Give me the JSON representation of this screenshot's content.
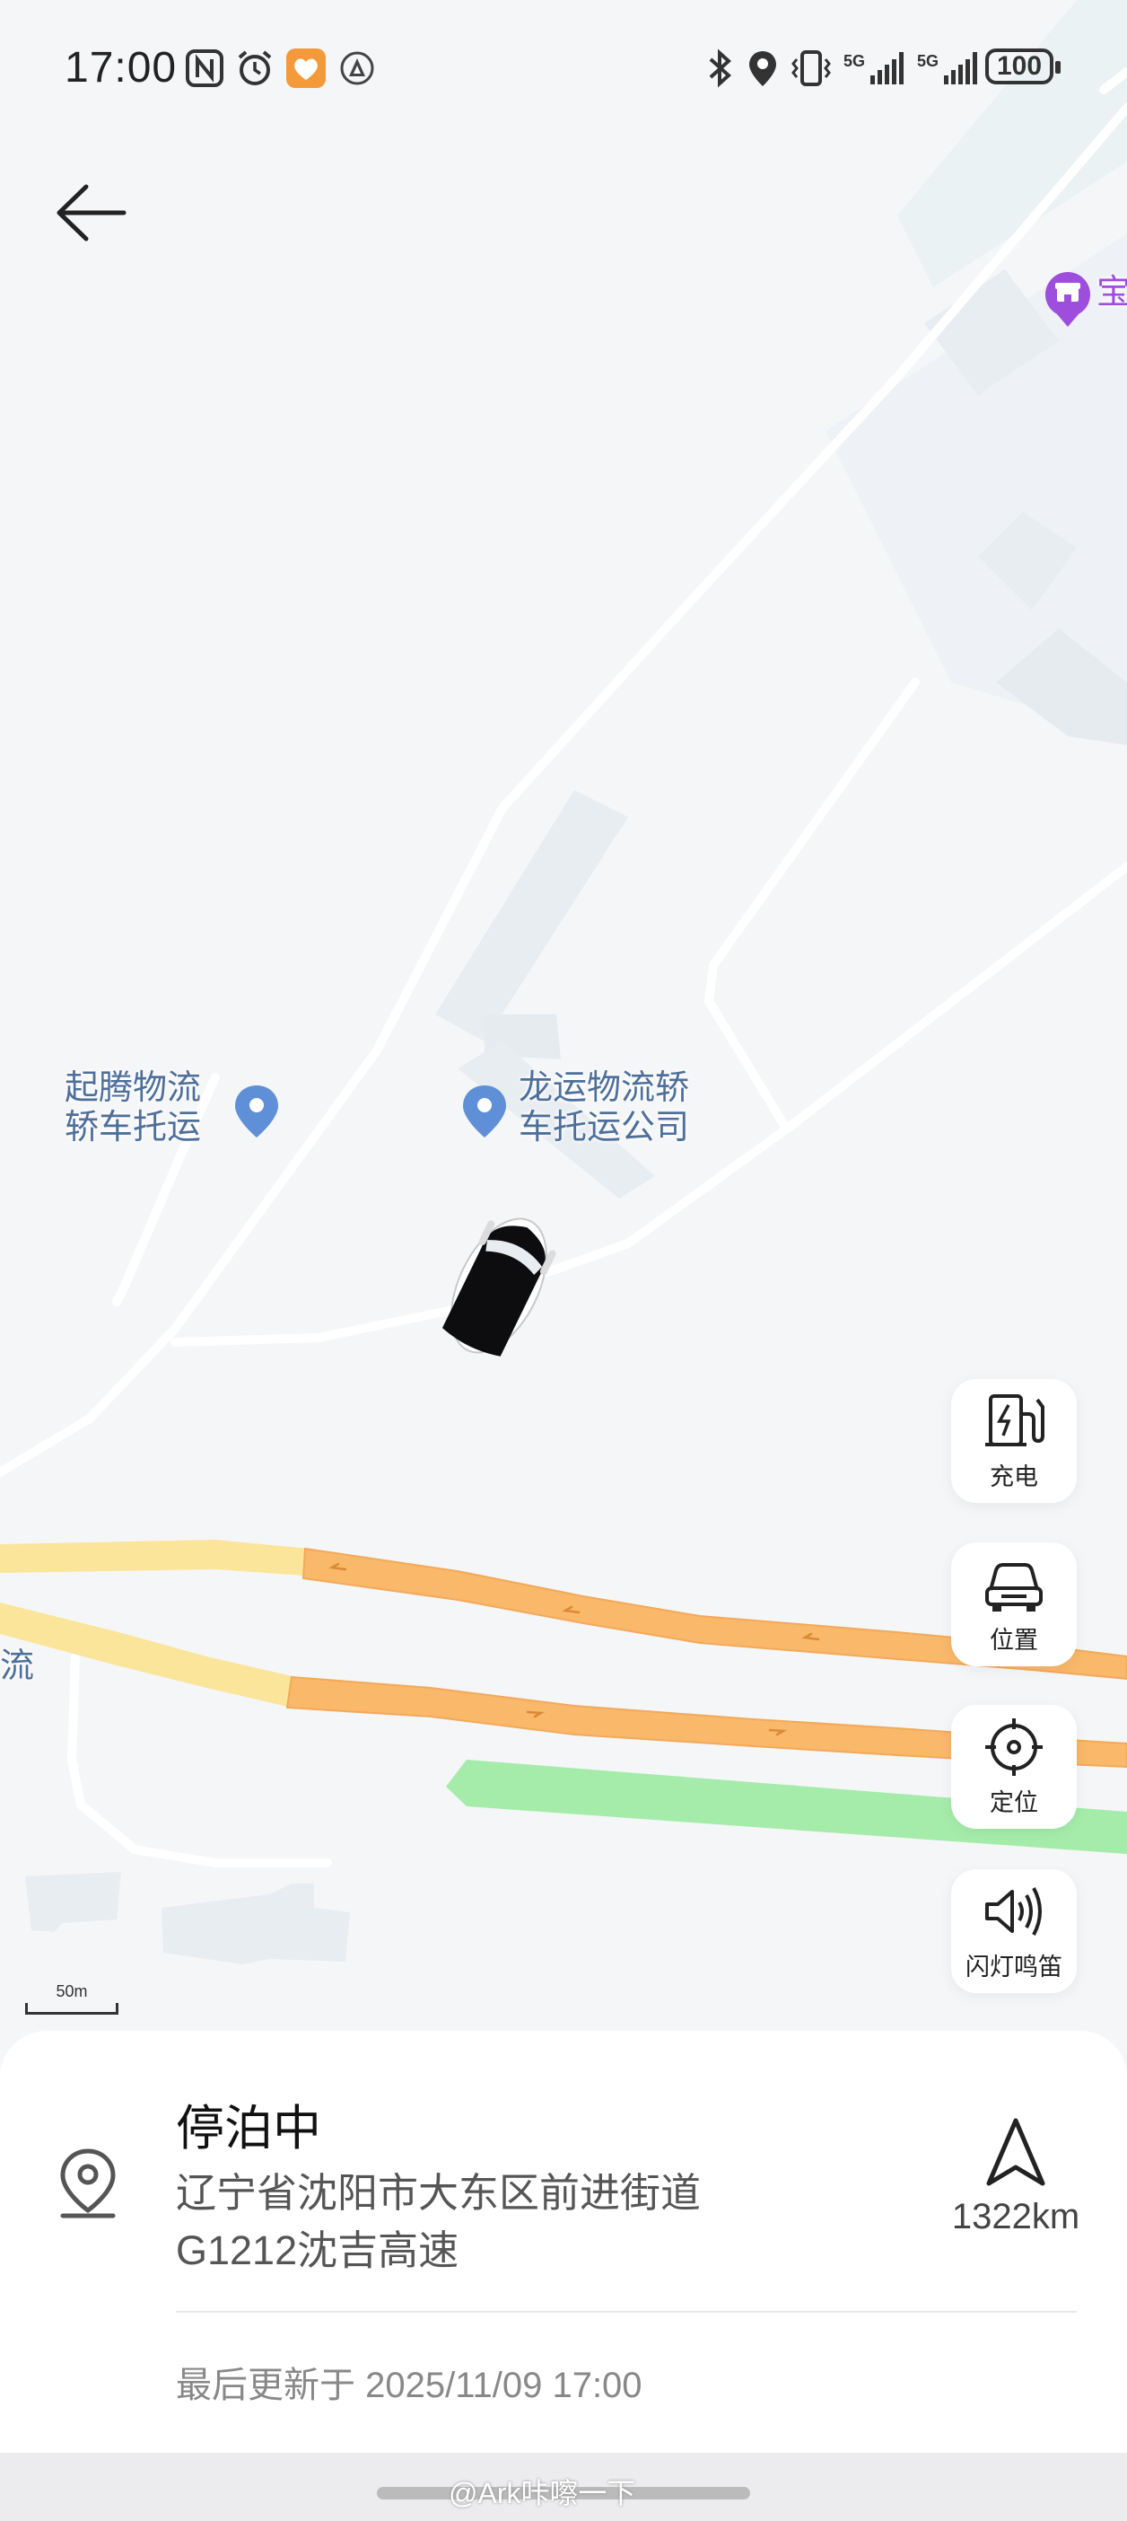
{
  "status_bar": {
    "time": "17:00",
    "icons": [
      "nfc-icon",
      "alarm-icon",
      "heart-app-icon",
      "navigation-app-icon",
      "bluetooth-icon",
      "location-icon",
      "vibrate-icon",
      "signal-5g-icon",
      "signal-5g-icon"
    ],
    "signal_label_1": "5G",
    "signal_label_2": "5G",
    "battery": "100"
  },
  "map": {
    "pois": [
      {
        "name": "起腾物流\n轿车托运"
      },
      {
        "name": "龙运物流轿\n车托运公司"
      }
    ],
    "edge_label_right": "宝",
    "edge_label_left": "流",
    "scale_label": "50m"
  },
  "side_buttons": {
    "charge": "充电",
    "position": "位置",
    "locate": "定位",
    "flash_horn": "闪灯鸣笛"
  },
  "panel": {
    "status": "停泊中",
    "address_line1": "辽宁省沈阳市大东区前进街道",
    "address_line2": "G1212沈吉高速",
    "distance": "1322km",
    "updated": "最后更新于 2025/11/09 17:00"
  },
  "watermark": "@Ark咔嚓一下",
  "colors": {
    "highway": "#f9b86a",
    "highway_light": "#fbe59a",
    "green_area": "#a5ecaa",
    "poi_pin": "#5f8fd6",
    "shop_pin": "#9d4edd"
  }
}
